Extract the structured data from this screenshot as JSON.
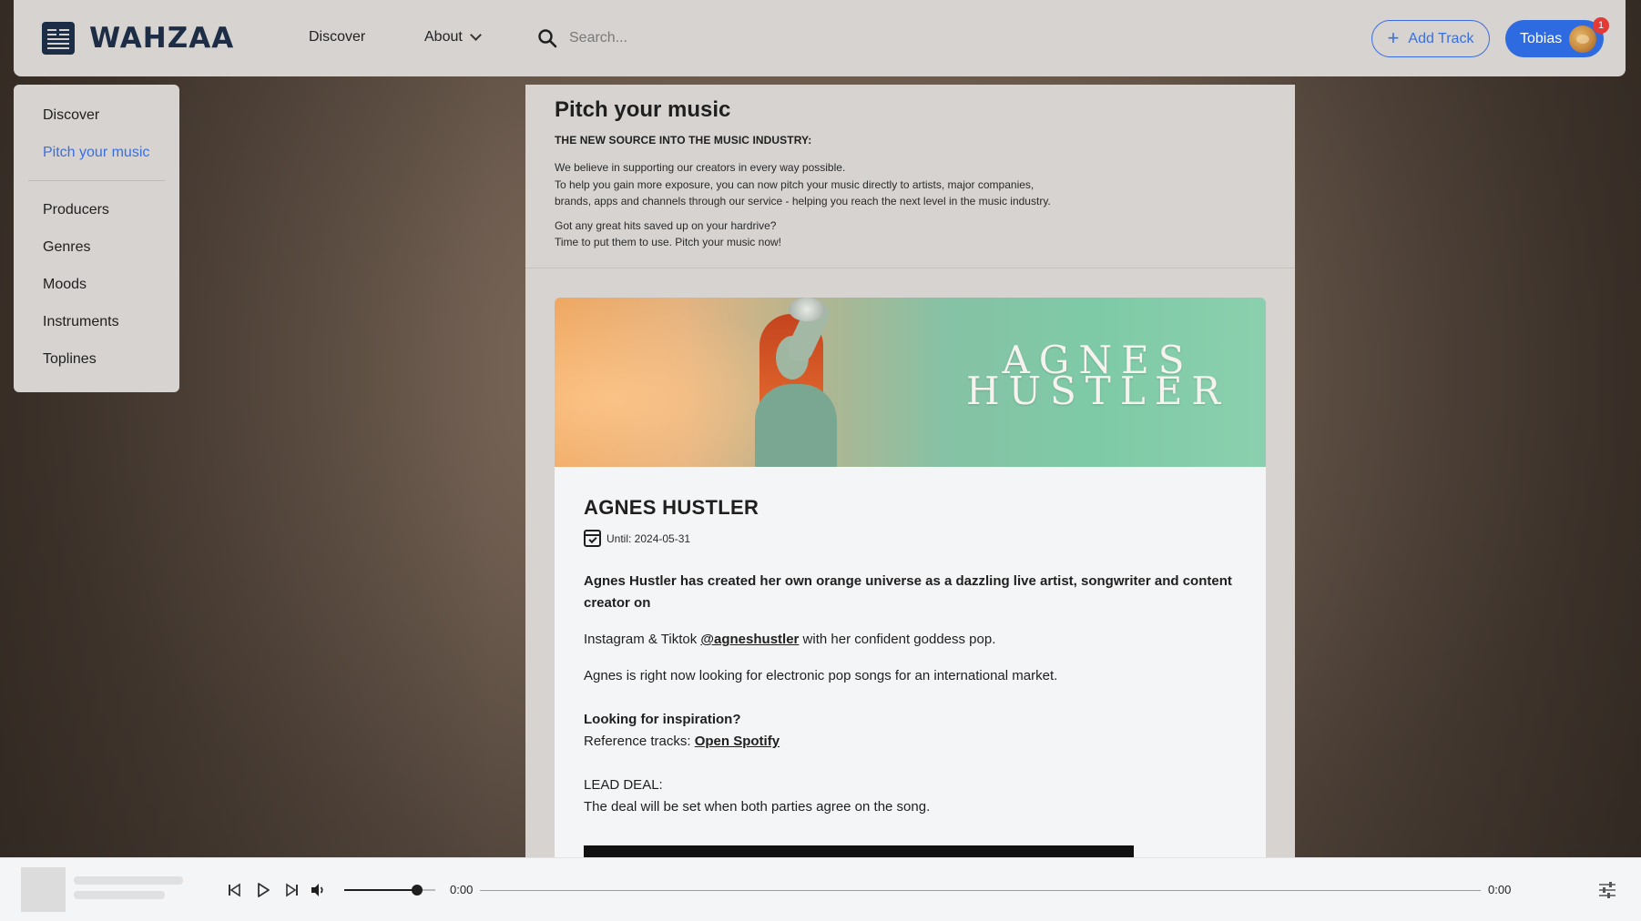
{
  "brand": {
    "name": "WAHZAA"
  },
  "nav": {
    "discover": "Discover",
    "about": "About"
  },
  "search": {
    "placeholder": "Search..."
  },
  "header": {
    "add_track": "Add Track",
    "user_name": "Tobias",
    "notification_count": "1"
  },
  "sidebar": {
    "items": [
      {
        "label": "Discover"
      },
      {
        "label": "Pitch your music",
        "active": true
      },
      {
        "label": "Producers"
      },
      {
        "label": "Genres"
      },
      {
        "label": "Moods"
      },
      {
        "label": "Instruments"
      },
      {
        "label": "Toplines"
      }
    ]
  },
  "intro": {
    "title": "Pitch your music",
    "subtitle": "THE NEW SOURCE INTO THE MUSIC INDUSTRY:",
    "para1_line1": "We believe in supporting our creators in every way possible.",
    "para1_line2": "To help you gain more exposure, you can now pitch your music directly to artists, major companies,",
    "para1_line3": "brands, apps and channels through our service - helping you reach the next level in the music industry.",
    "para2_line1": "Got any great hits saved up on your hardrive?",
    "para2_line2": "Time to put them to use. Pitch your music now!"
  },
  "card": {
    "banner_line1": "AGNES",
    "banner_line2": "HUSTLER",
    "title": "AGNES HUSTLER",
    "until": "Until: 2024-05-31",
    "description_bold": "Agnes Hustler has created her own orange universe as a dazzling live artist, songwriter and content creator on",
    "social_prefix": "Instagram & Tiktok ",
    "social_handle": "@agneshustler",
    "social_suffix": " with her confident goddess pop.",
    "looking": "Agnes is right now looking for electronic pop songs for an international market.",
    "inspiration_heading": "Looking for inspiration?",
    "reference_prefix": "Reference tracks: ",
    "reference_link": "Open Spotify",
    "lead_deal_label": "LEAD DEAL:",
    "lead_deal_text": "The deal will be set when both parties agree on the song."
  },
  "player": {
    "current_time": "0:00",
    "duration": "0:00",
    "volume_level": 0.8
  },
  "colors": {
    "accent": "#3a6fe0",
    "user_button": "#2f6be0",
    "badge": "#e53935",
    "brand": "#1c2d45"
  }
}
